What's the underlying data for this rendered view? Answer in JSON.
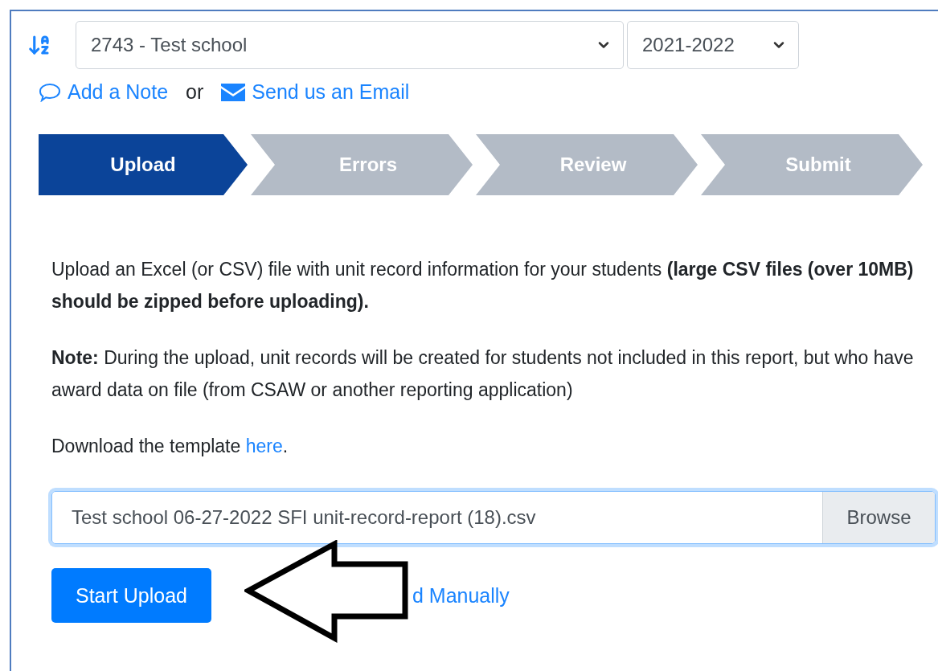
{
  "school_select": {
    "value": "2743 - Test school"
  },
  "year_select": {
    "value": "2021-2022"
  },
  "links": {
    "note": "Add a Note",
    "separator": "or",
    "email": "Send us an Email"
  },
  "steps": [
    {
      "label": "Upload",
      "selected": true
    },
    {
      "label": "Errors",
      "selected": false
    },
    {
      "label": "Review",
      "selected": false
    },
    {
      "label": "Submit",
      "selected": false
    }
  ],
  "intro": "Upload an Excel (or CSV) file with unit record information for your students **(large CSV files (over 10MB) should be zipped before uploading).**",
  "note": "**Note:** During the upload, unit records will be created for students not included in this report, but who have award data on file (from CSAW or another reporting application)",
  "template": {
    "text": "Download the template ",
    "link": "here",
    "end": "."
  },
  "file_input": {
    "value": "Test school 06-27-2022 SFI unit-record-report (18).csv",
    "button": "Browse",
    "focused": true
  },
  "start_button": "Start Upload",
  "manual_link": "d Manually"
}
